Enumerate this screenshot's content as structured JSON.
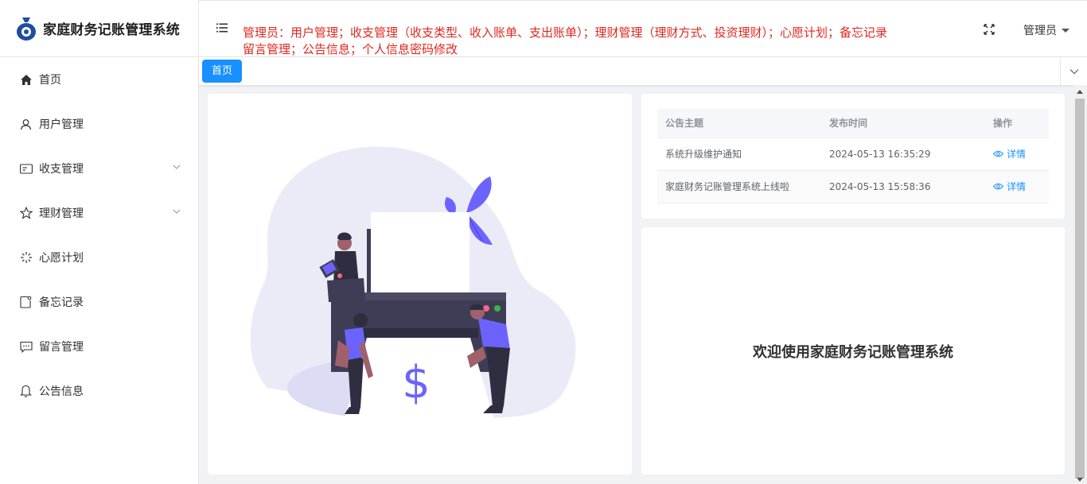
{
  "app": {
    "title": "家庭财务记账管理系统",
    "accent_color": "#1890ff",
    "notice_color": "#e0281f"
  },
  "sidebar": {
    "items": [
      {
        "label": "首页",
        "icon": "home-icon"
      },
      {
        "label": "用户管理",
        "icon": "user-icon"
      },
      {
        "label": "收支管理",
        "icon": "document-icon",
        "expandable": true
      },
      {
        "label": "理财管理",
        "icon": "star-icon",
        "expandable": true
      },
      {
        "label": "心愿计划",
        "icon": "loading-icon"
      },
      {
        "label": "备忘记录",
        "icon": "memo-icon"
      },
      {
        "label": "留言管理",
        "icon": "chat-icon"
      },
      {
        "label": "公告信息",
        "icon": "bell-icon"
      }
    ]
  },
  "header": {
    "notice_line1": "管理员：用户管理；收支管理（收支类型、收入账单、支出账单）；理财管理（理财方式、投资理财）；心愿计划；备忘记录",
    "notice_line2": "留言管理；公告信息；个人信息密码修改",
    "user_label": "管理员"
  },
  "tags": {
    "active": "首页"
  },
  "notices_table": {
    "columns": [
      "公告主题",
      "发布时间",
      "操作"
    ],
    "rows": [
      {
        "title": "系统升级维护通知",
        "time": "2024-05-13 16:35:29",
        "action": "详情"
      },
      {
        "title": "家庭财务记账管理系统上线啦",
        "time": "2024-05-13 15:58:36",
        "action": "详情"
      }
    ]
  },
  "welcome": {
    "text": "欢迎使用家庭财务记账管理系统"
  }
}
